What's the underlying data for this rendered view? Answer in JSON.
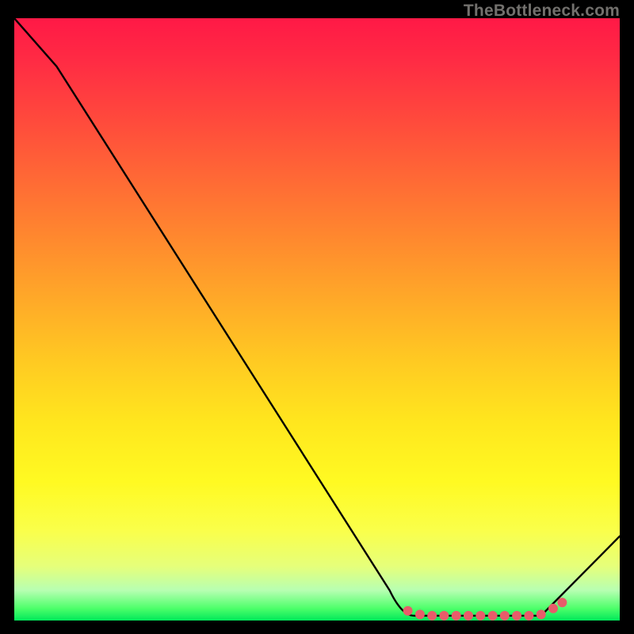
{
  "attribution": "TheBottleneck.com",
  "chart_data": {
    "type": "line",
    "title": "",
    "xlabel": "",
    "ylabel": "",
    "xlim": [
      0,
      100
    ],
    "ylim": [
      0,
      100
    ],
    "x": [
      0,
      7,
      62,
      66,
      87,
      100
    ],
    "values": [
      100,
      92,
      5,
      0.8,
      0.8,
      14
    ],
    "marker_region": {
      "x_start": 65,
      "x_end": 91,
      "color": "#e85c6a",
      "points_x": [
        65,
        67,
        69,
        71,
        73,
        75,
        77,
        79,
        81,
        83,
        85,
        87,
        89,
        90.5
      ],
      "points_y": [
        1.6,
        1.0,
        0.8,
        0.8,
        0.8,
        0.8,
        0.8,
        0.8,
        0.8,
        0.8,
        0.8,
        1.0,
        2.0,
        3.0
      ]
    },
    "gradient_stops": [
      {
        "pos": 0.0,
        "color": "#ff1946"
      },
      {
        "pos": 0.27,
        "color": "#ff6a35"
      },
      {
        "pos": 0.57,
        "color": "#ffca22"
      },
      {
        "pos": 0.85,
        "color": "#faff4a"
      },
      {
        "pos": 1.0,
        "color": "#00e85a"
      }
    ]
  },
  "colors": {
    "page_bg": "#000000",
    "curve": "#000000",
    "marker": "#e85c6a",
    "attribution_text": "#72706d"
  }
}
